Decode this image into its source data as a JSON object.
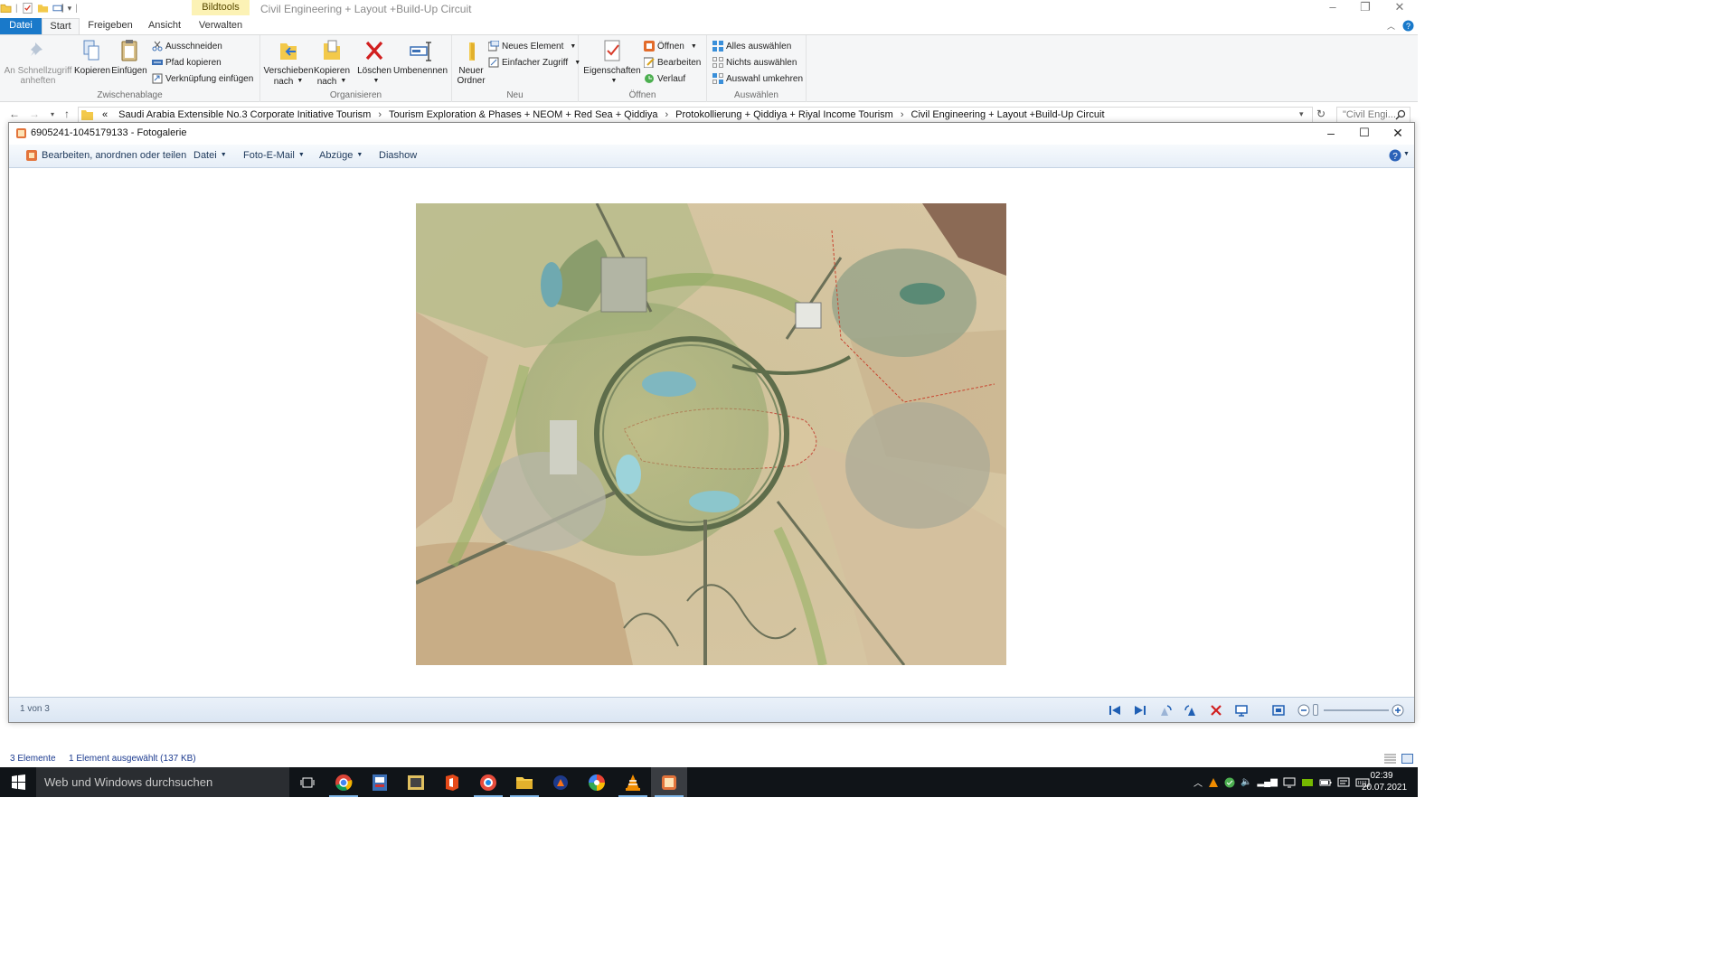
{
  "explorer": {
    "title": "Civil Engineering + Layout +Build-Up Circuit",
    "context_tab": "Bildtools",
    "tabs": [
      "Datei",
      "Start",
      "Freigeben",
      "Ansicht",
      "Verwalten"
    ],
    "ribbon": {
      "clipboard": {
        "pin_label_1": "An Schnellzugriff",
        "pin_label_2": "anheften",
        "copy": "Kopieren",
        "paste": "Einfügen",
        "cut": "Ausschneiden",
        "copy_path": "Pfad kopieren",
        "paste_shortcut": "Verknüpfung einfügen",
        "group": "Zwischenablage"
      },
      "organize": {
        "move_1": "Verschieben",
        "move_2": "nach",
        "copyto_1": "Kopieren",
        "copyto_2": "nach",
        "delete": "Löschen",
        "rename": "Umbenennen",
        "group": "Organisieren"
      },
      "new": {
        "new_folder_1": "Neuer",
        "new_folder_2": "Ordner",
        "new_item": "Neues Element",
        "easy_access": "Einfacher Zugriff",
        "group": "Neu"
      },
      "open": {
        "properties": "Eigenschaften",
        "open": "Öffnen",
        "edit": "Bearbeiten",
        "history": "Verlauf",
        "group": "Öffnen"
      },
      "select": {
        "select_all": "Alles auswählen",
        "select_none": "Nichts auswählen",
        "invert": "Auswahl umkehren",
        "group": "Auswählen"
      }
    },
    "address": {
      "prefix": "«",
      "crumbs": [
        "Saudi Arabia Extensible No.3 Corporate Initiative Tourism",
        "Tourism Exploration & Phases + NEOM + Red Sea + Qiddiya",
        "Protokollierung + Qiddiya + Riyal Income Tourism",
        "Civil Engineering + Layout +Build-Up Circuit"
      ],
      "search_placeholder": "\"Civil Engi..."
    },
    "status": {
      "items": "3 Elemente",
      "selected": "1 Element ausgewählt (137 KB)"
    }
  },
  "gallery": {
    "title": "6905241-1045179133 - Fotogalerie",
    "toolbar": {
      "edit": "Bearbeiten, anordnen oder teilen",
      "file": "Datei",
      "email": "Foto-E-Mail",
      "prints": "Abzüge",
      "slideshow": "Diashow"
    },
    "counter": "1 von 3"
  },
  "taskbar": {
    "search_placeholder": "Web und Windows durchsuchen",
    "time": "02:39",
    "date": "20.07.2021"
  },
  "colors": {
    "accent": "#1979ca",
    "context_tab": "#fcf2b5",
    "taskbar": "#101418"
  }
}
